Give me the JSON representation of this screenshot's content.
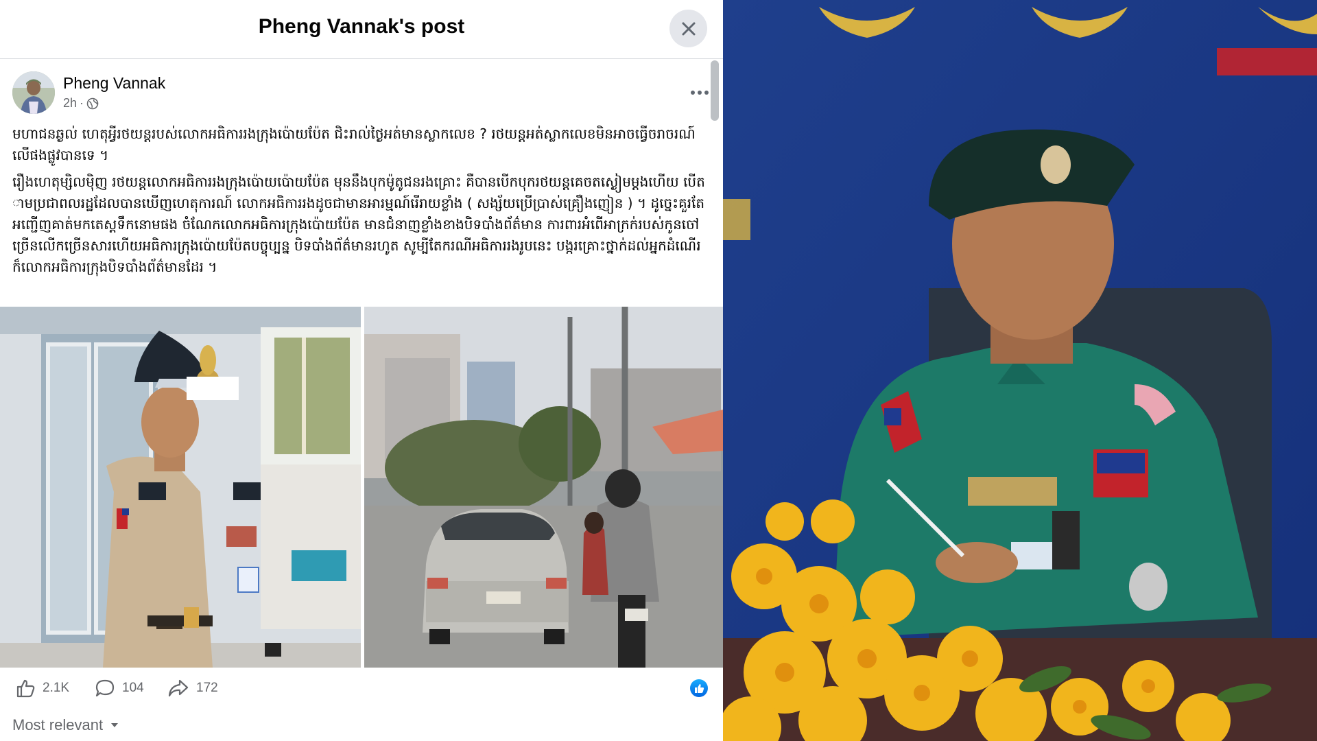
{
  "dialog": {
    "title": "Pheng Vannak's post"
  },
  "post": {
    "author": "Pheng Vannak",
    "time": "2h",
    "privacy_separator": "·",
    "paragraphs": [
      "មហាជនឆ្ងល់ ហេតុអ្វីរថយន្តរបស់លោកអធិការរងក្រុងប៉ោយប៉ែត ជិះរាល់ថ្ងៃអត់មានស្លាកលេខ ? រថយន្តអត់ស្លាកលេខមិនអាចធ្វើចរាចរណ៍លើផងផ្លូវបានទេ ។",
      "រឿងហេតុម្សិលម៉ិញ រថយន្តលោកអធិការរងក្រុងប៉ោយប៉ោយប៉ែត មុននឹងបុកម៉ូតូជនរងគ្រោះ គឺបានបើកបុករថយន្តគេចតស្ងៀមម្តងហើយ បើតាមប្រជាពលរដ្ឋដែលបានឃើញហេតុការណ៍ លោកអធិការរងដូចជាមានអារម្មណ៍រើរាយខ្លាំង ( សង្ស័យប្រើប្រាស់គ្រឿងញៀន ) ។ ដូច្នេះគួរតែអញ្ជើញគាត់មកតេស្តទឹកនោមផង ចំណែកលោកអធិការក្រុងប៉ោយប៉ែត មានជំនាញខ្លាំងខាងបិទបាំងព័ត៌មាន ការពារអំពើអាក្រក់របស់កូនចៅ ច្រើនលើកច្រើនសារហើយអធិការក្រុងប៉ោយប៉ែតបច្ចុប្បន្ន បិទបាំងព័ត៌មានរហូត សូម្បីតែករណីអធិការរងរូបនេះ បង្ករគ្រោះថ្នាក់ដល់អ្នកដំណើរក៏លោកអធិការក្រុងបិទបាំងព័ត៌មានដែរ ។"
    ]
  },
  "stats": {
    "likes": "2.1K",
    "comments": "104",
    "shares": "172"
  },
  "comments_sort": {
    "label": "Most relevant"
  },
  "colors": {
    "facebook_blue": "#0866ff",
    "meta_gray": "#65676b"
  },
  "icons": [
    "close-icon",
    "globe-icon",
    "more-icon",
    "like-icon",
    "comment-icon",
    "share-icon",
    "chevron-down-icon"
  ]
}
